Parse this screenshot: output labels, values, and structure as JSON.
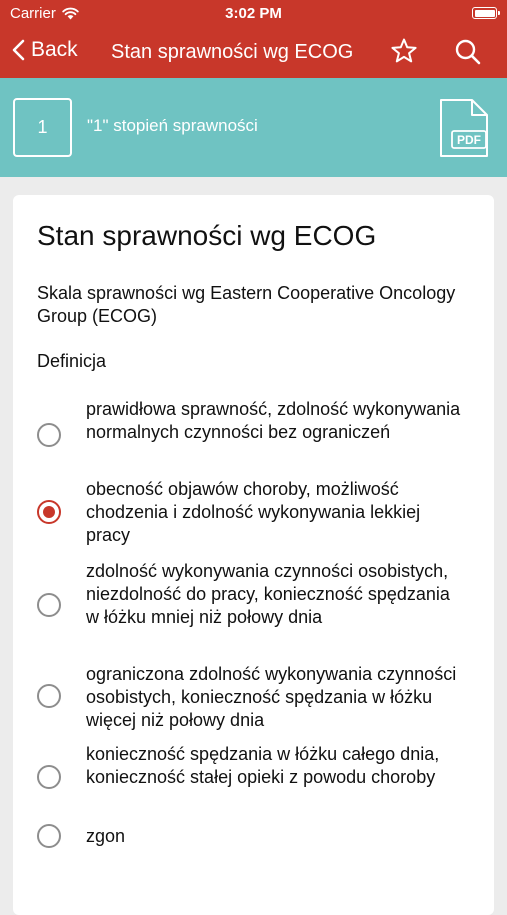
{
  "status_bar": {
    "carrier": "Carrier",
    "time": "3:02 PM"
  },
  "nav": {
    "back_label": "Back",
    "title": "Stan sprawności wg ECOG"
  },
  "score": {
    "value": "1",
    "label": "\"1\" stopień sprawności",
    "pdf_label": "PDF"
  },
  "card": {
    "title": "Stan sprawności wg ECOG",
    "description": "Skala sprawności wg Eastern Cooperative Oncology Group (ECOG)",
    "definition_label": "Definicja",
    "options": [
      {
        "text": "prawidłowa sprawność, zdolność wykonywania normalnych czynności bez ograniczeń",
        "selected": false
      },
      {
        "text": "obecność objawów choroby, możliwość chodzenia i zdolność wykonywania lekkiej pracy",
        "selected": true
      },
      {
        "text": "zdolność wykonywania czynności osobistych, niezdolność do pracy, konieczność spędzania w łóżku mniej niż połowy dnia",
        "selected": false
      },
      {
        "text": "ograniczona zdolność wykonywania czynności osobistych, konieczność spędzania w łóżku więcej niż połowy dnia",
        "selected": false
      },
      {
        "text": "konieczność spędzania w łóżku całego dnia, konieczność stałej opieki z powodu choroby",
        "selected": false
      },
      {
        "text": "zgon",
        "selected": false
      }
    ]
  },
  "colors": {
    "accent": "#c8372a",
    "band": "#6fc3c2"
  },
  "icons": [
    "wifi-icon",
    "battery-icon",
    "chevron-left-icon",
    "star-icon",
    "search-icon",
    "pdf-file-icon"
  ]
}
